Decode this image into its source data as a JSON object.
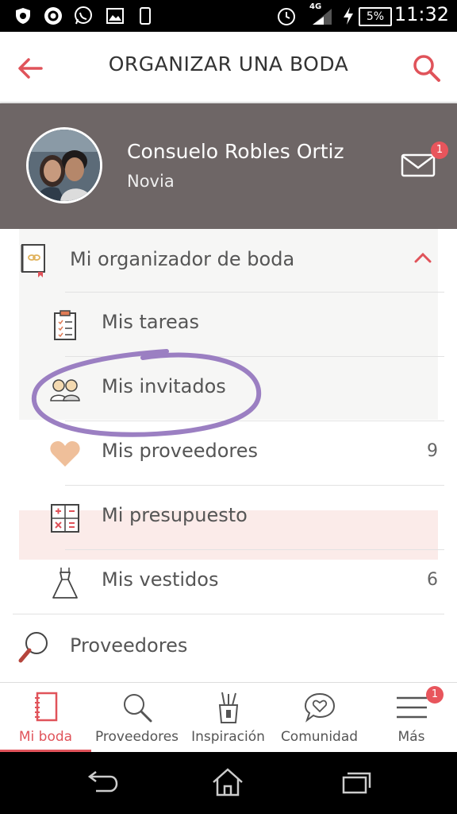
{
  "status_bar": {
    "network": "4G",
    "battery": "5%",
    "time": "11:32",
    "icons": [
      "shield-icon",
      "circle-app-icon",
      "whatsapp-icon",
      "image-icon",
      "phone-icon",
      "alarm-icon",
      "signal-icon",
      "charging-icon",
      "battery-icon"
    ]
  },
  "app_bar": {
    "title": "ORGANIZAR UNA BODA",
    "back_icon": "arrow-left-icon",
    "search_icon": "search-icon",
    "accent": "#e0535a"
  },
  "profile": {
    "name": "Consuelo Robles Ortiz",
    "role": "Novia",
    "mail_badge": "1",
    "background": "#6e6666"
  },
  "menu": {
    "section": {
      "label": "Mi organizador de boda",
      "icon": "planner-book-icon",
      "toggle_icon": "chevron-up-icon"
    },
    "items": [
      {
        "label": "Mis tareas",
        "count": "",
        "icon": "clipboard-checklist-icon"
      },
      {
        "label": "Mis invitados",
        "count": "",
        "icon": "guests-couple-icon"
      },
      {
        "label": "Mis proveedores",
        "count": "9",
        "icon": "heart-icon"
      },
      {
        "label": "Mi presupuesto",
        "count": "",
        "icon": "calculator-icon"
      },
      {
        "label": "Mis vestidos",
        "count": "6",
        "icon": "dress-icon"
      }
    ],
    "providers": {
      "label": "Proveedores",
      "icon": "magnifier-icon"
    },
    "annotation_color": "#9b7fc2"
  },
  "bottom_nav": {
    "items": [
      {
        "label": "Mi boda",
        "icon": "notebook-icon",
        "active": true
      },
      {
        "label": "Proveedores",
        "icon": "search-icon",
        "active": false
      },
      {
        "label": "Inspiración",
        "icon": "pencil-cup-icon",
        "active": false
      },
      {
        "label": "Comunidad",
        "icon": "chat-heart-icon",
        "active": false
      },
      {
        "label": "Más",
        "icon": "menu-icon",
        "active": false,
        "badge": "1"
      }
    ]
  },
  "system_nav": [
    "back-icon",
    "home-icon",
    "recents-icon"
  ]
}
